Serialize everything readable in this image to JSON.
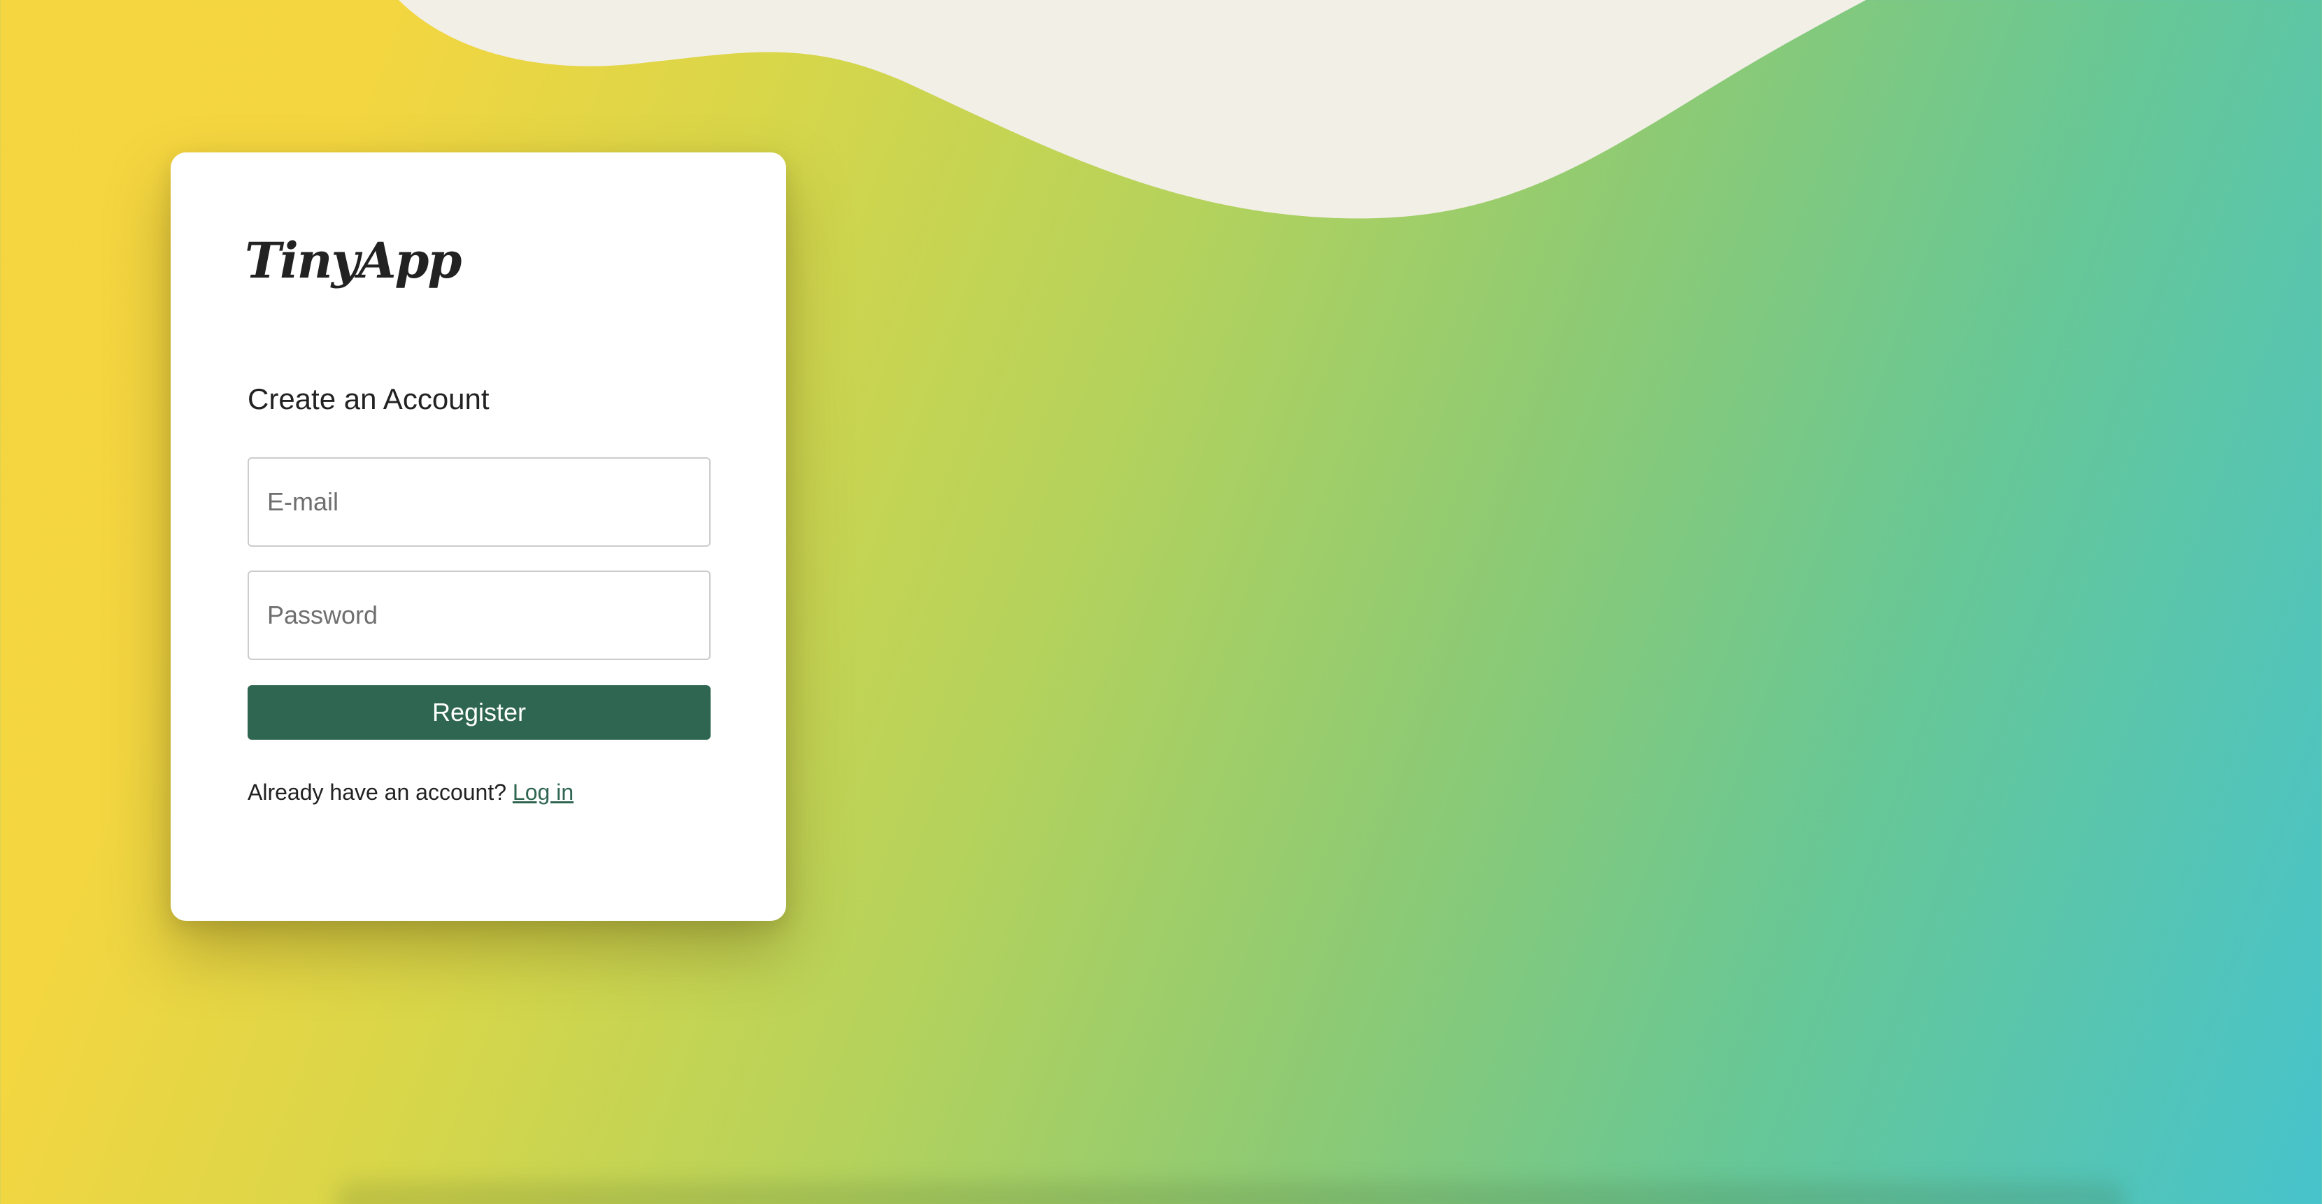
{
  "app": {
    "logo_text": "TinyApp"
  },
  "form": {
    "heading": "Create an Account",
    "email_placeholder": "E-mail",
    "password_placeholder": "Password",
    "register_label": "Register",
    "login_prompt": "Already have an account?",
    "login_link_label": "Log in"
  },
  "colors": {
    "accent": "#2f6651",
    "background_gradient_start": "#f5d540",
    "background_gradient_mid": "#b4d25c",
    "background_gradient_end": "#47c3cc",
    "top_wave": "#f2efe7",
    "card_background": "#ffffff"
  }
}
